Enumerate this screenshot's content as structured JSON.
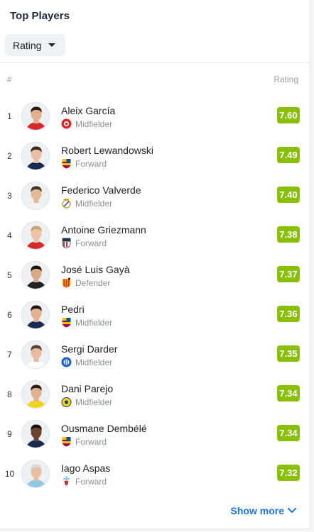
{
  "widget": {
    "title": "Top Players",
    "filter_label": "Rating",
    "col_rank": "#",
    "col_rating": "Rating",
    "show_more": "Show more"
  },
  "players": [
    {
      "rank": "1",
      "name": "Aleix García",
      "position": "Midfielder",
      "rating": "7.60",
      "club_icon": "girona-crest-icon",
      "skin": "#e2b08f",
      "hair": "#2b1d16",
      "shirt": "#d62a2a"
    },
    {
      "rank": "2",
      "name": "Robert Lewandowski",
      "position": "Forward",
      "rating": "7.49",
      "club_icon": "barcelona-crest-icon",
      "skin": "#e8bfa3",
      "hair": "#3a2a20",
      "shirt": "#1b2a55"
    },
    {
      "rank": "3",
      "name": "Federico Valverde",
      "position": "Midfielder",
      "rating": "7.40",
      "club_icon": "real-madrid-crest-icon",
      "skin": "#e5b995",
      "hair": "#4a3426",
      "shirt": "#f2f2f2"
    },
    {
      "rank": "4",
      "name": "Antoine Griezmann",
      "position": "Forward",
      "rating": "7.38",
      "club_icon": "atletico-crest-icon",
      "skin": "#ecc3a6",
      "hair": "#c9a070",
      "shirt": "#d52b2b"
    },
    {
      "rank": "5",
      "name": "José Luis Gayà",
      "position": "Defender",
      "rating": "7.37",
      "club_icon": "valencia-crest-icon",
      "skin": "#d9a988",
      "hair": "#1e1612",
      "shirt": "#222222"
    },
    {
      "rank": "6",
      "name": "Pedri",
      "position": "Midfielder",
      "rating": "7.36",
      "club_icon": "barcelona-crest-icon",
      "skin": "#e0b090",
      "hair": "#1b1411",
      "shirt": "#1b2a55"
    },
    {
      "rank": "7",
      "name": "Sergi Darder",
      "position": "Midfielder",
      "rating": "7.35",
      "club_icon": "espanyol-crest-icon",
      "skin": "#e6bba0",
      "hair": "#5a4030",
      "shirt": "#ffffff"
    },
    {
      "rank": "8",
      "name": "Dani Parejo",
      "position": "Midfielder",
      "rating": "7.34",
      "club_icon": "villarreal-crest-icon",
      "skin": "#e0b090",
      "hair": "#2a1e18",
      "shirt": "#f2d31b"
    },
    {
      "rank": "9",
      "name": "Ousmane Dembélé",
      "position": "Forward",
      "rating": "7.34",
      "club_icon": "barcelona-crest-icon",
      "skin": "#6b4530",
      "hair": "#1a1210",
      "shirt": "#1b2a55"
    },
    {
      "rank": "10",
      "name": "Iago Aspas",
      "position": "Forward",
      "rating": "7.32",
      "club_icon": "celta-crest-icon",
      "skin": "#e8bfa3",
      "hair": "#d8d8d8",
      "shirt": "#8ecae6"
    }
  ],
  "colors": {
    "rating_badge": "#89bf06",
    "link": "#1a73e8"
  }
}
